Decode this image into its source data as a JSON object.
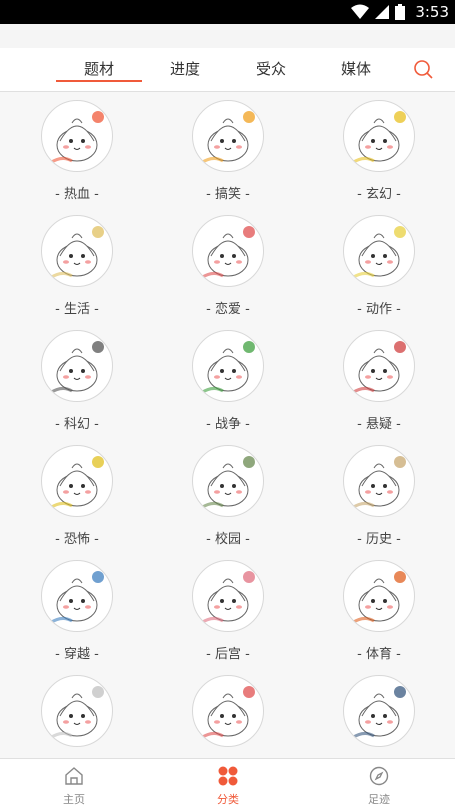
{
  "status_bar": {
    "time": "3:53"
  },
  "tabs": [
    "题材",
    "进度",
    "受众",
    "媒体"
  ],
  "active_tab": 0,
  "categories": [
    {
      "label": "- 热血 -",
      "icon": "fire-bun-icon",
      "accent": "#f05a3a"
    },
    {
      "label": "- 搞笑 -",
      "icon": "laughing-bun-icon",
      "accent": "#f0a020"
    },
    {
      "label": "- 玄幻 -",
      "icon": "mystic-bun-icon",
      "accent": "#e8c020"
    },
    {
      "label": "- 生活 -",
      "icon": "bread-bun-icon",
      "accent": "#e0c060"
    },
    {
      "label": "- 恋爱 -",
      "icon": "love-bun-icon",
      "accent": "#e05050"
    },
    {
      "label": "- 动作 -",
      "icon": "action-bun-icon",
      "accent": "#e8d040"
    },
    {
      "label": "- 科幻 -",
      "icon": "ufo-bun-icon",
      "accent": "#555555"
    },
    {
      "label": "- 战争 -",
      "icon": "war-bun-icon",
      "accent": "#40a040"
    },
    {
      "label": "- 悬疑 -",
      "icon": "question-bun-icon",
      "accent": "#d04040"
    },
    {
      "label": "- 恐怖 -",
      "icon": "skull-bun-icon",
      "accent": "#e0c020"
    },
    {
      "label": "- 校园 -",
      "icon": "school-bun-icon",
      "accent": "#6a8a50"
    },
    {
      "label": "- 历史 -",
      "icon": "scroll-bun-icon",
      "accent": "#c8a870"
    },
    {
      "label": "- 穿越 -",
      "icon": "car-bun-icon",
      "accent": "#4080c0"
    },
    {
      "label": "- 后宫 -",
      "icon": "palace-bun-icon",
      "accent": "#e07080"
    },
    {
      "label": "- 体育 -",
      "icon": "basketball-bun-icon",
      "accent": "#e06020"
    },
    {
      "label": "",
      "icon": "city-bun-icon",
      "accent": "#c0c0c0"
    },
    {
      "label": "",
      "icon": "calligraphy-bun-icon",
      "accent": "#e05050"
    },
    {
      "label": "",
      "icon": "hair-bun-icon",
      "accent": "#3a5a80"
    }
  ],
  "bottom_nav": [
    {
      "label": "主页",
      "icon": "home-icon"
    },
    {
      "label": "分类",
      "icon": "category-icon"
    },
    {
      "label": "足迹",
      "icon": "compass-icon"
    }
  ],
  "active_nav": 1,
  "colors": {
    "accent": "#f05a3a",
    "text": "#333333",
    "muted": "#888888"
  }
}
